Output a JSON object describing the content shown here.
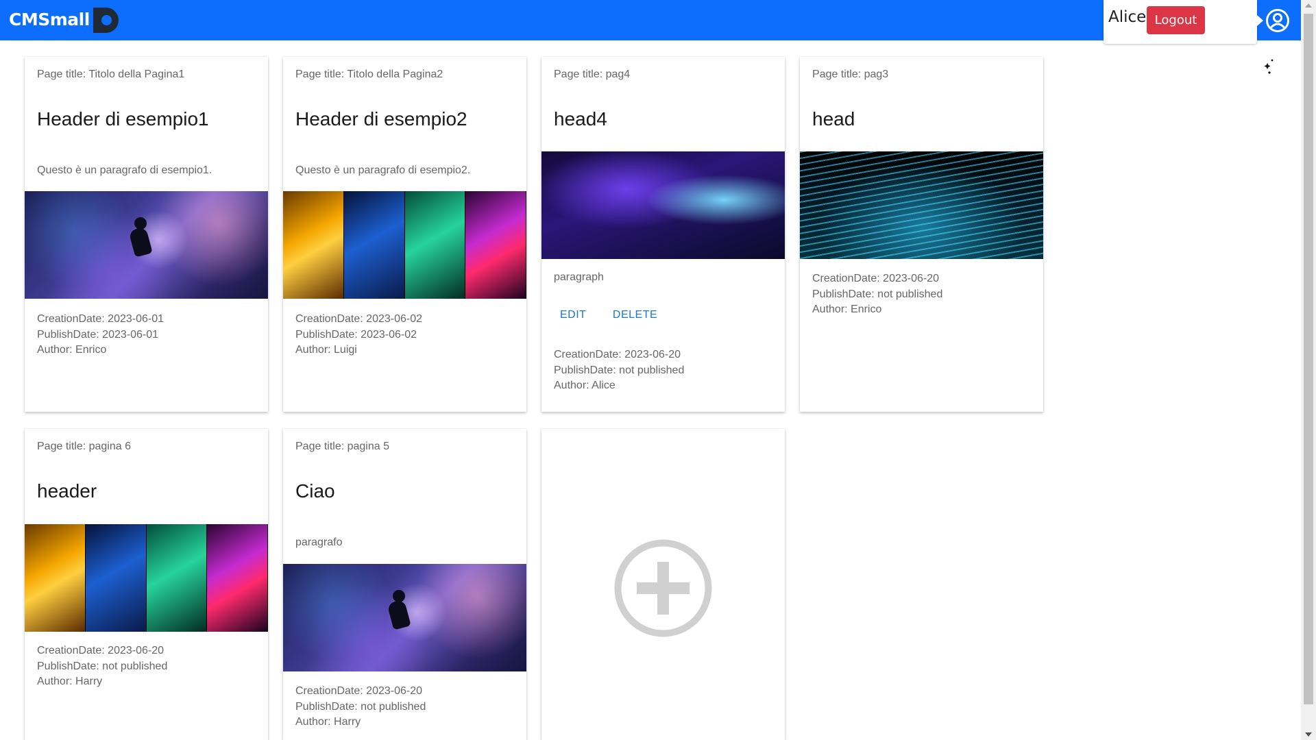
{
  "navbar": {
    "brand": "CMSmall",
    "user_name": "Alice",
    "logout_label": "Logout",
    "color": "#0d6efd"
  },
  "icons": {
    "brand_logo": "brand-logo-icon",
    "account": "account-circle-icon",
    "theme": "theme-toggle-icon",
    "add": "add-circle-icon"
  },
  "colors": {
    "logout": "#dc3545",
    "action": "#1976d2"
  },
  "cards": [
    {
      "title": "Page title: Titolo della Pagina1",
      "header": "Header di esempio1",
      "paragraph": "Questo è un paragrafo di esempio1.",
      "creation": "CreationDate: 2023-06-01",
      "publish": "PublishDate: 2023-06-01",
      "author": "Author: Enrico"
    },
    {
      "title": "Page title: Titolo della Pagina2",
      "header": "Header di esempio2",
      "paragraph": "Questo è un paragrafo di esempio2.",
      "creation": "CreationDate: 2023-06-02",
      "publish": "PublishDate: 2023-06-02",
      "author": "Author: Luigi"
    },
    {
      "title": "Page title: pag4",
      "header": "head4",
      "paragraph": "paragraph",
      "edit_label": "EDIT",
      "delete_label": "DELETE",
      "creation": "CreationDate: 2023-06-20",
      "publish": "PublishDate: not published",
      "author": "Author: Alice"
    },
    {
      "title": "Page title: pag3",
      "header": "head",
      "creation": "CreationDate: 2023-06-20",
      "publish": "PublishDate: not published",
      "author": "Author: Enrico"
    },
    {
      "title": "Page title: pagina 6",
      "header": "header",
      "creation": "CreationDate: 2023-06-20",
      "publish": "PublishDate: not published",
      "author": "Author: Harry"
    },
    {
      "title": "Page title: pagina 5",
      "header": "Ciao",
      "paragraph": "paragrafo",
      "creation": "CreationDate: 2023-06-20",
      "publish": "PublishDate: not published",
      "author": "Author: Harry"
    }
  ]
}
